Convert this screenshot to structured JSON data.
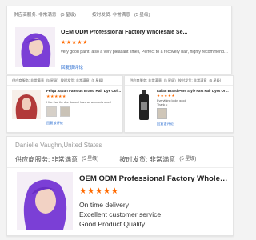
{
  "colors": {
    "star": "#ff6a00",
    "link": "#2d6fd1",
    "hair": "#7b3fd6"
  },
  "review1": {
    "service": "供应商服务: 非常满意",
    "service_level": "(5 星级)",
    "delivery": "按时发货: 非常满意",
    "delivery_level": "(5 星级)",
    "title": "OEM ODM Professional Factory Wholesale Se...",
    "stars": "★★★★★",
    "text": "very good paint, also a very pleasant smell, Perfect to a recovery hair, highly recommend+++",
    "link": "回复该评论"
  },
  "review2": {
    "service": "供应商服务: 非常满意",
    "service_level": "(5 星级)",
    "delivery": "按时发货: 非常满意",
    "delivery_level": "(5 星级)",
    "title": "Feiqu Japan Famous Brand Hair Dye Color OE...",
    "stars": "★★★★★",
    "text": "I like that the dye doesn't have an ammonia smell",
    "link": "回复该评论"
  },
  "review3": {
    "service": "供应商服务: 非常满意",
    "service_level": "(5 星级)",
    "delivery": "按时发货: 非常满意",
    "delivery_level": "(5 星级)",
    "title": "Italian Brand Pure Style Fast Hair Dyes Organic...",
    "stars": "★★★★★",
    "text1": "Everything looks good",
    "text2": "Thank u",
    "link": "回复该评论"
  },
  "review4": {
    "reviewer": "Danielle Vaughn,United States",
    "service": "供应商服务: 非常满意",
    "service_level": "(5 星级)",
    "delivery": "按时发货: 非常满意",
    "delivery_level": "(5 星级)",
    "title": "OEM ODM Professional Factory Wholesale Se...",
    "stars": "★★★★★",
    "line1": "On time delivery",
    "line2": "Excellent customer service",
    "line3": "Good Product Quality"
  }
}
